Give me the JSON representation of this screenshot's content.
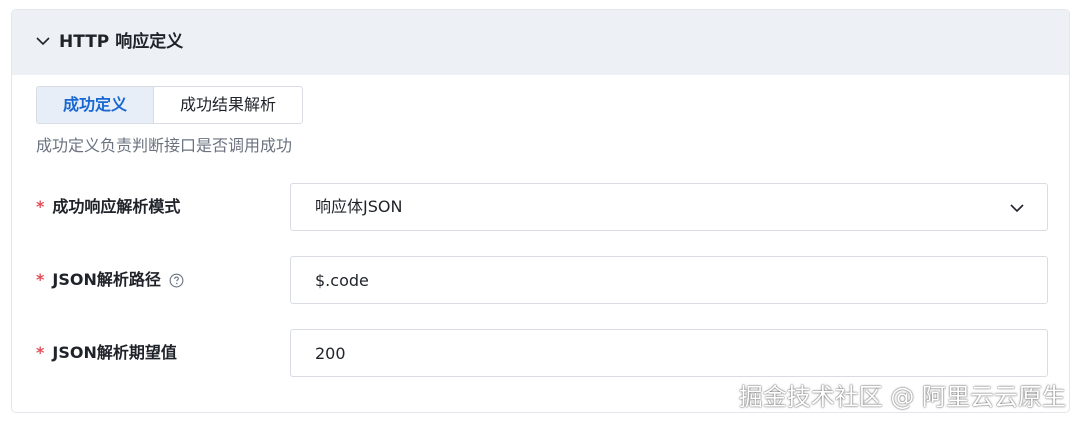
{
  "panel": {
    "title": "HTTP 响应定义",
    "collapse_icon": "chevron-down-icon"
  },
  "tabs": [
    {
      "label": "成功定义",
      "active": true
    },
    {
      "label": "成功结果解析",
      "active": false
    }
  ],
  "tab_description": "成功定义负责判断接口是否调用成功",
  "form": {
    "mode": {
      "required": "*",
      "label": "成功响应解析模式",
      "value": "响应体JSON",
      "icon": "chevron-down-icon"
    },
    "path": {
      "required": "*",
      "label": "JSON解析路径",
      "help_icon": "question-circle-icon",
      "value": "$.code"
    },
    "expected": {
      "required": "*",
      "label": "JSON解析期望值",
      "value": "200"
    }
  },
  "watermark": "掘金技术社区 @ 阿里云云原生",
  "colors": {
    "header_bg": "#edf1f6",
    "active_tab_bg": "#e7eef8",
    "active_tab_text": "#1967d2",
    "required": "#e34d59"
  }
}
